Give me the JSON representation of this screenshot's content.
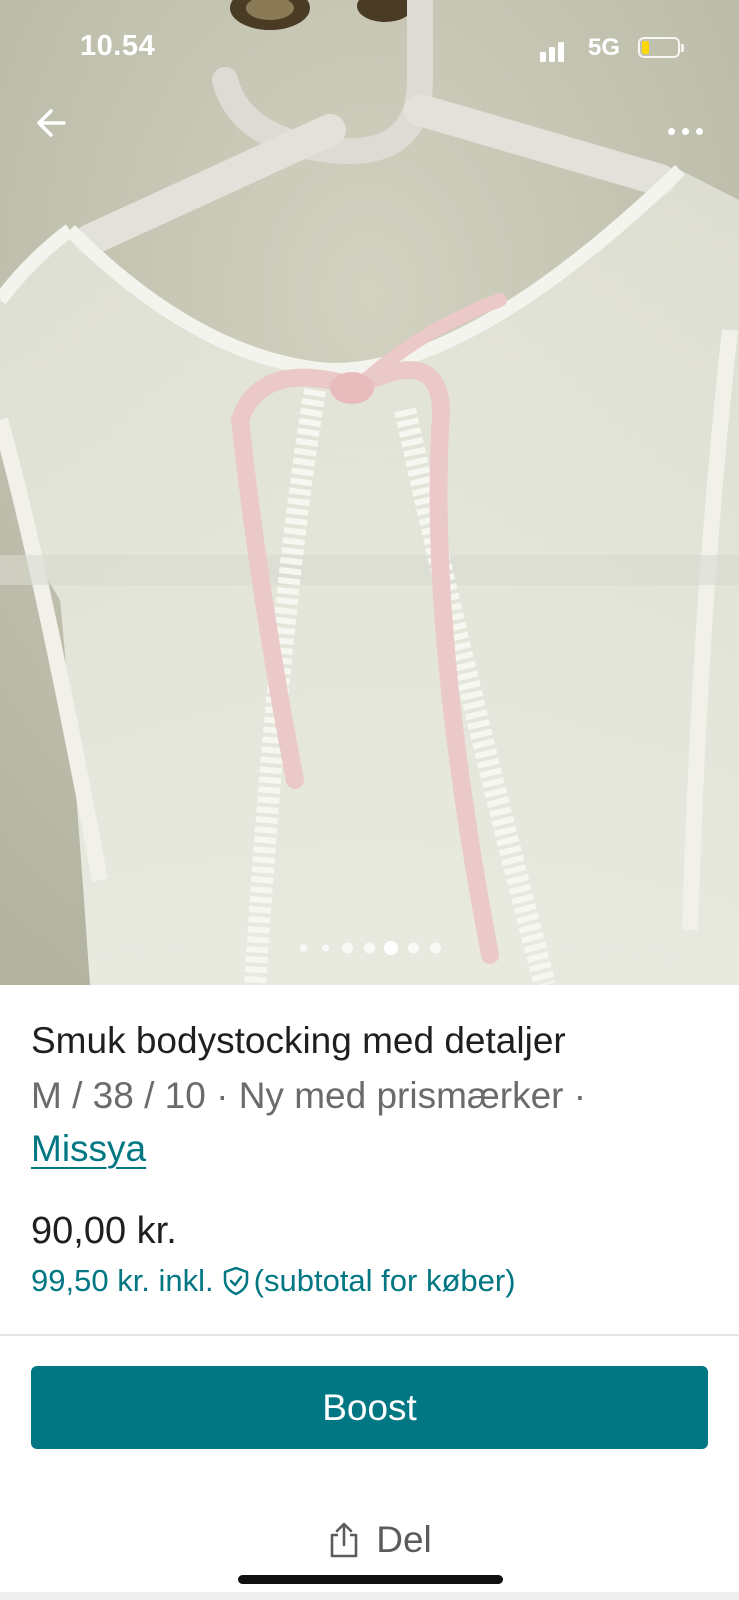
{
  "status_bar": {
    "time": "10.54",
    "network": "5G",
    "battery_level": 0.2,
    "battery_color": "#ffd60a"
  },
  "photo": {
    "pager": {
      "count": 7,
      "active_index": 4
    }
  },
  "listing": {
    "title": "Smuk bodystocking med detaljer",
    "meta": "M / 38 / 10 · Ny med prismærker ·",
    "brand": "Missya",
    "price": "90,00 kr.",
    "price_incl_amount": "99,50 kr. inkl.",
    "price_incl_note": "(subtotal for køber)"
  },
  "actions": {
    "boost_label": "Boost",
    "share_label": "Del"
  },
  "colors": {
    "accent": "#007782",
    "link": "#017783",
    "text_primary": "#1f1f1f",
    "text_secondary": "#6b6b6b"
  },
  "icons": {
    "back": "arrow-left-icon",
    "more": "more-dots-icon",
    "shield": "shield-check-icon",
    "share": "share-icon"
  }
}
